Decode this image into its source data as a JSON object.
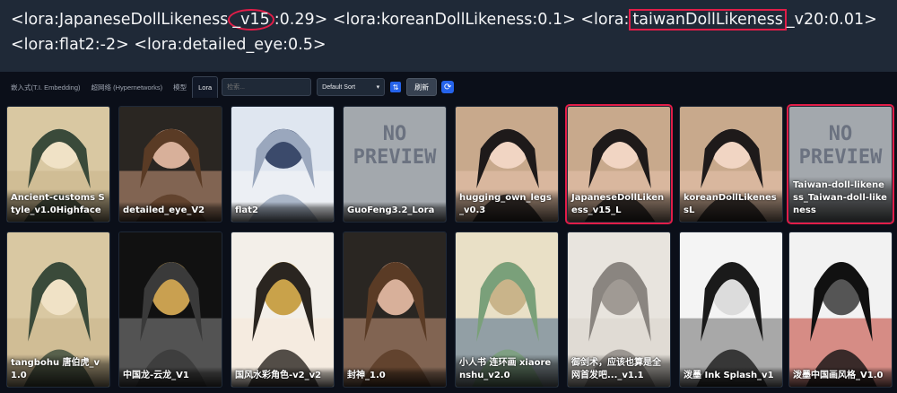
{
  "prompt": {
    "line1_a": "<lora:JapaneseDollLikeness",
    "line1_b": "_v15",
    "line1_c": ":0.29> <lora:koreanDollLikeness:0.1> <lora:",
    "line1_d": "taiwanDollLikeness",
    "line1_e": "_v20:0.01>",
    "line2": "<lora:flat2:-2> <lora:detailed_eye:0.5>"
  },
  "tabs": {
    "embedding": "嵌入式(T.I. Embedding)",
    "hypernetworks": "超网络 (Hypernetworks)",
    "checkpoints": "模型",
    "lora": "Lora"
  },
  "search": {
    "placeholder": "检索..."
  },
  "sort": {
    "value": "Default Sort",
    "chevron": "▾"
  },
  "sortdir_icon": "⇅",
  "refresh_label": "刷新",
  "cycle_icon": "⟳",
  "nopreview_text": [
    "NO",
    "PREVIEW"
  ],
  "cards_row1": [
    {
      "name": "Ancient-customs Style_v1.0Highface",
      "thumb": "painting-lady"
    },
    {
      "name": "detailed_eye_V2",
      "thumb": "portrait-man"
    },
    {
      "name": "flat2",
      "thumb": "anime-girls"
    },
    {
      "name": "GuoFeng3.2_Lora",
      "thumb": "no-preview"
    },
    {
      "name": "hugging_own_legs_v0.3",
      "thumb": "portrait-woman"
    },
    {
      "name": "JapaneseDollLikeness_v15_L",
      "thumb": "portrait-woman",
      "highlight": true
    },
    {
      "name": "koreanDollLikenessL",
      "thumb": "portrait-woman"
    },
    {
      "name": "Taiwan-doll-likeness_Taiwan-doll-likeness",
      "thumb": "no-preview",
      "highlight": true
    }
  ],
  "cards_row2": [
    {
      "name": "tangbohu 唐伯虎_v1.0",
      "thumb": "painting-lady"
    },
    {
      "name": "中国龙-云龙_V1",
      "thumb": "dragon"
    },
    {
      "name": "国风水彩角色-v2_v2",
      "thumb": "anime-queen"
    },
    {
      "name": "封神_1.0",
      "thumb": "portrait-man"
    },
    {
      "name": "小人书 连环画 xiaorenshu_v2.0",
      "thumb": "illustration"
    },
    {
      "name": "御剑术，应该也算是全网首发吧..._v1.1",
      "thumb": "sketch"
    },
    {
      "name": "泼墨 Ink Splash_v1",
      "thumb": "ink"
    },
    {
      "name": "泼墨中国画风格_V1.0",
      "thumb": "ink-red"
    }
  ],
  "colors": {
    "highlight": "#e11d48",
    "accent": "#2563eb"
  }
}
